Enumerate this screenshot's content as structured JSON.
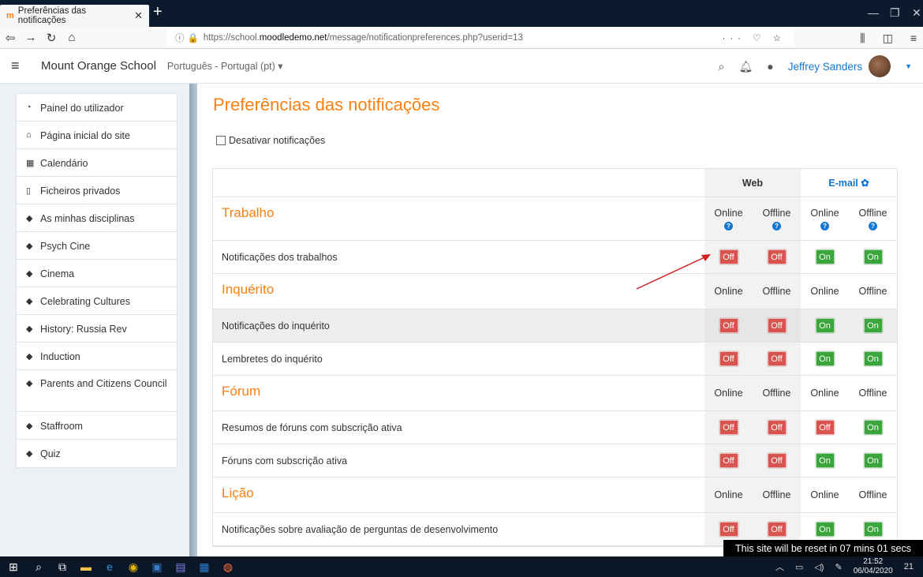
{
  "browser": {
    "tab_title": "Preferências das notificações",
    "url_prefix": "https://school.",
    "url_host": "moodledemo.net",
    "url_path": "/message/notificationpreferences.php?userid=13"
  },
  "header": {
    "site_name": "Mount Orange School",
    "language": "Português - Portugal (pt) ▾",
    "user_name": "Jeffrey Sanders"
  },
  "sidebar": {
    "items": [
      {
        "label": "Painel do utilizador",
        "icon": "dashboard-icon"
      },
      {
        "label": "Página inicial do site",
        "icon": "home-icon"
      },
      {
        "label": "Calendário",
        "icon": "calendar-icon"
      },
      {
        "label": "Ficheiros privados",
        "icon": "file-icon"
      },
      {
        "label": "As minhas disciplinas",
        "icon": "graduation-cap-icon"
      },
      {
        "label": "Psych Cine",
        "icon": "graduation-cap-icon"
      },
      {
        "label": "Cinema",
        "icon": "graduation-cap-icon"
      },
      {
        "label": "Celebrating Cultures",
        "icon": "graduation-cap-icon"
      },
      {
        "label": "History: Russia Rev",
        "icon": "graduation-cap-icon"
      },
      {
        "label": "Induction",
        "icon": "graduation-cap-icon"
      },
      {
        "label": "Parents and Citizens Council",
        "icon": "graduation-cap-icon"
      },
      {
        "label": "Staffroom",
        "icon": "graduation-cap-icon"
      },
      {
        "label": "Quiz",
        "icon": "graduation-cap-icon"
      }
    ]
  },
  "main": {
    "title": "Preferências das notificações",
    "disable_label": "Desativar notificações",
    "col_web": "Web",
    "col_email": "E-mail",
    "online": "Online",
    "offline": "Offline",
    "off": "Off",
    "on": "On",
    "sections": [
      {
        "name": "Trabalho",
        "help": true,
        "rows": [
          {
            "label": "Notificações dos trabalhos",
            "states": [
              "Off",
              "Off",
              "On",
              "On"
            ]
          }
        ]
      },
      {
        "name": "Inquérito",
        "help": false,
        "rows": [
          {
            "label": "Notificações do inquérito",
            "states": [
              "Off",
              "Off",
              "On",
              "On"
            ],
            "shade": true
          },
          {
            "label": "Lembretes do inquérito",
            "states": [
              "Off",
              "Off",
              "On",
              "On"
            ]
          }
        ]
      },
      {
        "name": "Fórum",
        "help": false,
        "rows": [
          {
            "label": "Resumos de fóruns com subscrição ativa",
            "states": [
              "Off",
              "Off",
              "Off",
              "On"
            ]
          },
          {
            "label": "Fóruns com subscrição ativa",
            "states": [
              "Off",
              "Off",
              "On",
              "On"
            ]
          }
        ]
      },
      {
        "name": "Lição",
        "help": false,
        "rows": [
          {
            "label": "Notificações sobre avaliação de perguntas de desenvolvimento",
            "states": [
              "Off",
              "Off",
              "On",
              "On"
            ]
          }
        ]
      }
    ]
  },
  "reset_notice": "This site will be reset in 07 mins 01 secs",
  "taskbar": {
    "time": "21:52",
    "date": "06/04/2020",
    "notifications": "21"
  },
  "colors": {
    "brand_orange": "#f98012",
    "link_blue": "#1177d1",
    "off_red": "#d9534f",
    "on_green": "#3aa53a"
  }
}
